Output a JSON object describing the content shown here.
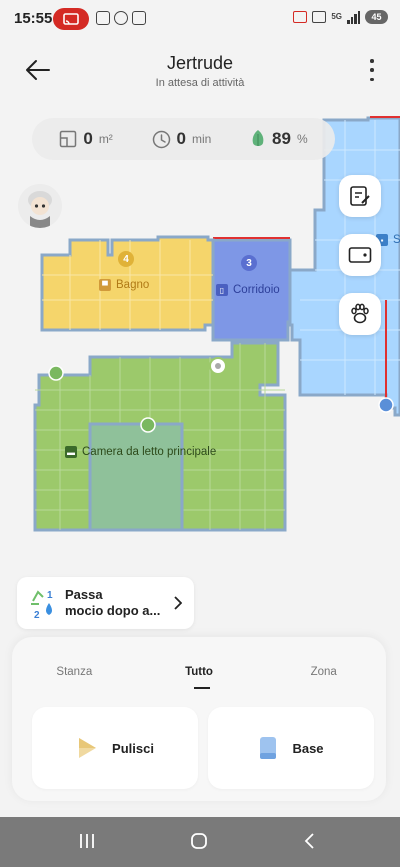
{
  "status_bar": {
    "time": "15:55",
    "network": "5G",
    "battery": "45"
  },
  "header": {
    "title": "Jertrude",
    "subtitle": "In attesa di attività"
  },
  "stats": {
    "area_value": "0",
    "area_unit": "m²",
    "time_value": "0",
    "time_unit": "min",
    "battery_value": "89",
    "battery_unit": "%"
  },
  "map": {
    "rooms": [
      {
        "number": "4",
        "name": "Bagno",
        "color": "#f5d56b"
      },
      {
        "number": "3",
        "name": "Corridoio",
        "color": "#7e97e6"
      },
      {
        "number": "",
        "name": "Camera da letto principale",
        "color": "#9cc96b"
      },
      {
        "number": "",
        "name": "S",
        "color": "#a9d6ff"
      }
    ]
  },
  "mop_card": {
    "line1": "Passa",
    "line2": "mocio dopo a..."
  },
  "tabs": [
    "Stanza",
    "Tutto",
    "Zona"
  ],
  "active_tab": "Tutto",
  "actions": {
    "clean_label": "Pulisci",
    "base_label": "Base"
  },
  "icons": [
    "arrow-left-icon",
    "more-vertical-icon",
    "area-icon",
    "clock-icon",
    "battery-leaf-icon",
    "edit-map-icon",
    "camera-icon",
    "pet-paw-icon",
    "recycle-icon",
    "water-drop-icon",
    "chevron-right-icon",
    "play-icon",
    "dock-icon",
    "nav-recents-icon",
    "nav-home-icon",
    "nav-back-icon"
  ]
}
